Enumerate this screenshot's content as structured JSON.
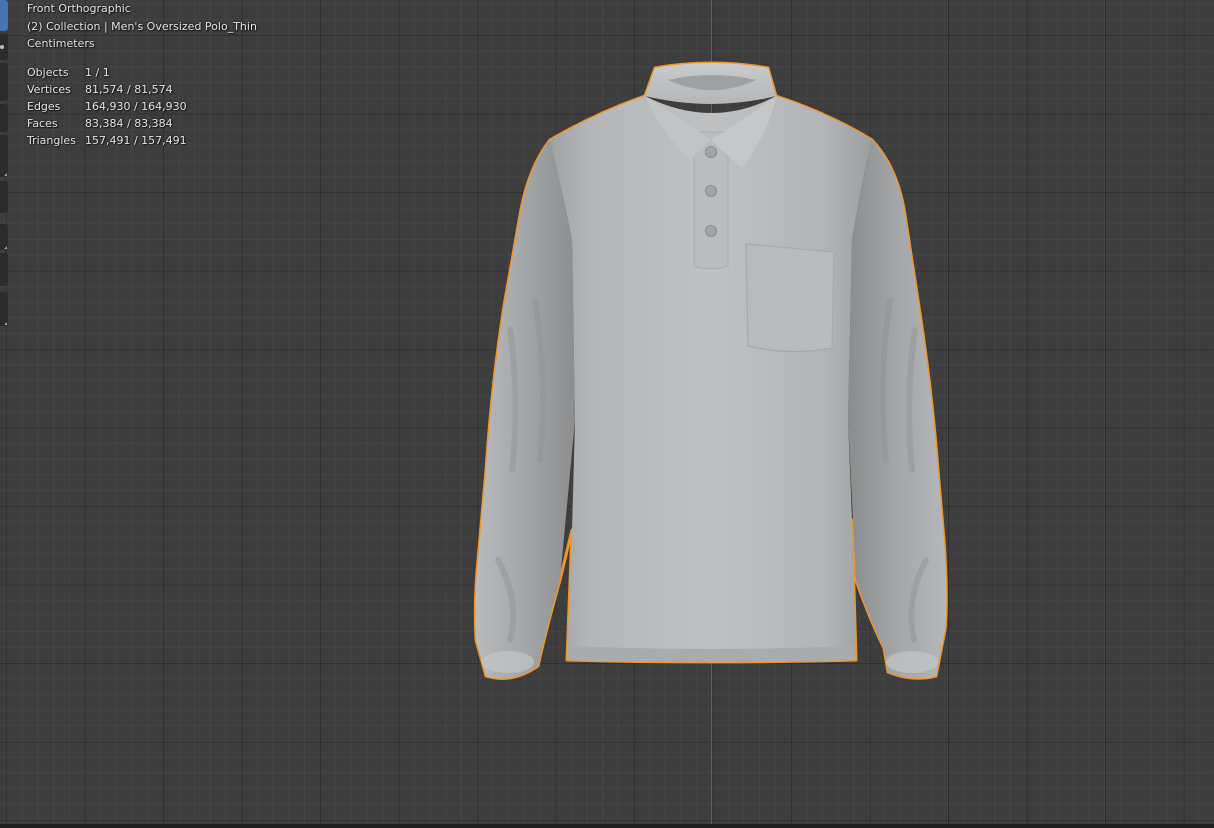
{
  "viewport": {
    "view_name": "Front Orthographic",
    "collection_label": "(2) Collection | Men's Oversized Polo_Thin",
    "units": "Centimeters"
  },
  "statistics": {
    "rows": [
      {
        "label": "Objects",
        "value": "1 / 1"
      },
      {
        "label": "Vertices",
        "value": "81,574 / 81,574"
      },
      {
        "label": "Edges",
        "value": "164,930 / 164,930"
      },
      {
        "label": "Faces",
        "value": "83,384 / 83,384"
      },
      {
        "label": "Triangles",
        "value": "157,491 / 157,491"
      }
    ]
  },
  "colors": {
    "background": "#3d3d3d",
    "selection_outline": "#f0952b",
    "z_axis": "#2f67c7",
    "active_tool": "#4772b3"
  },
  "toolbar": {
    "icons": [
      "select-box-icon",
      "cursor-icon",
      "move-icon",
      "rotate-icon",
      "scale-icon",
      "transform-icon",
      "annotate-icon",
      "measure-icon",
      "add-cube-icon"
    ]
  }
}
